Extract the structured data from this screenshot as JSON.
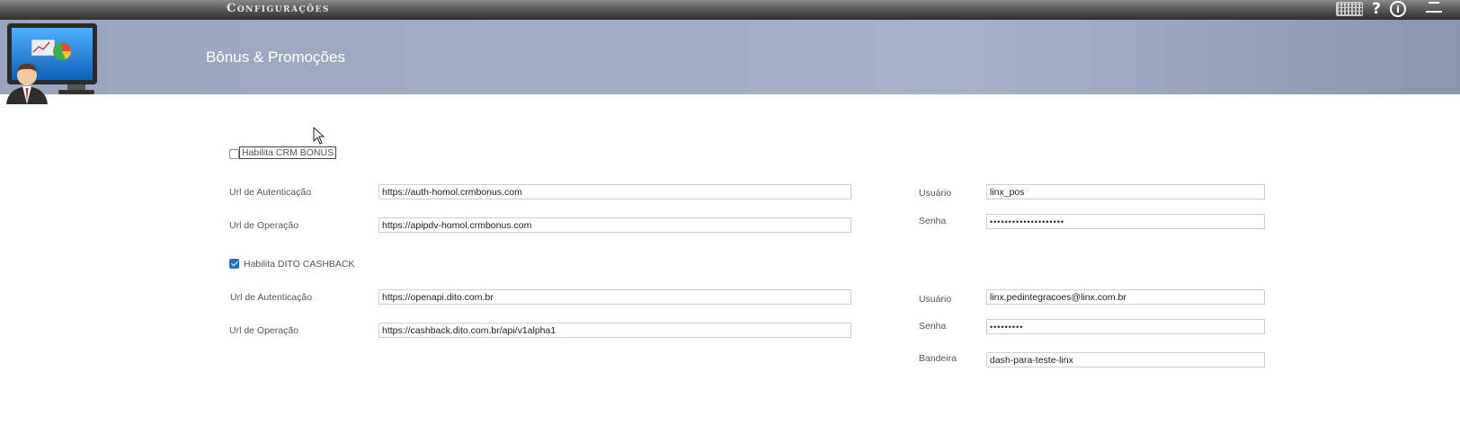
{
  "window": {
    "title": "Configurações"
  },
  "header": {
    "page_title": "Bônus & Promoções"
  },
  "crm": {
    "enable_label": "Habilita CRM BONUS",
    "enabled": false,
    "auth_url_label": "Url de Autenticação",
    "auth_url_value": "https://auth-homol.crmbonus.com",
    "op_url_label": "Url de Operação",
    "op_url_value": "https://apipdv-homol.crmbonus.com",
    "user_label": "Usuário",
    "user_value": "linx_pos",
    "password_label": "Senha",
    "password_value": "••••••••••••••••••••"
  },
  "dito": {
    "enable_label": "Habilita DITO CASHBACK",
    "enabled": true,
    "auth_url_label": "Url de Autenticação",
    "auth_url_value": "https://openapi.dito.com.br",
    "op_url_label": "Url de Operação",
    "op_url_value": "https://cashback.dito.com.br/api/v1alpha1",
    "user_label": "Usuário",
    "user_value": "linx.pedintegracoes@linx.com.br",
    "password_label": "Senha",
    "password_value": "•••••••••",
    "flag_label": "Bandeira",
    "flag_value": "dash-para-teste-linx"
  },
  "colors": {
    "checkbox_accent": "#1e6fd0",
    "header_band": "#a3adc5"
  },
  "icons": [
    "keyboard-icon",
    "help-icon",
    "info-icon",
    "minimize-icon",
    "cursor-arrow-icon",
    "app-logo-icon"
  ]
}
